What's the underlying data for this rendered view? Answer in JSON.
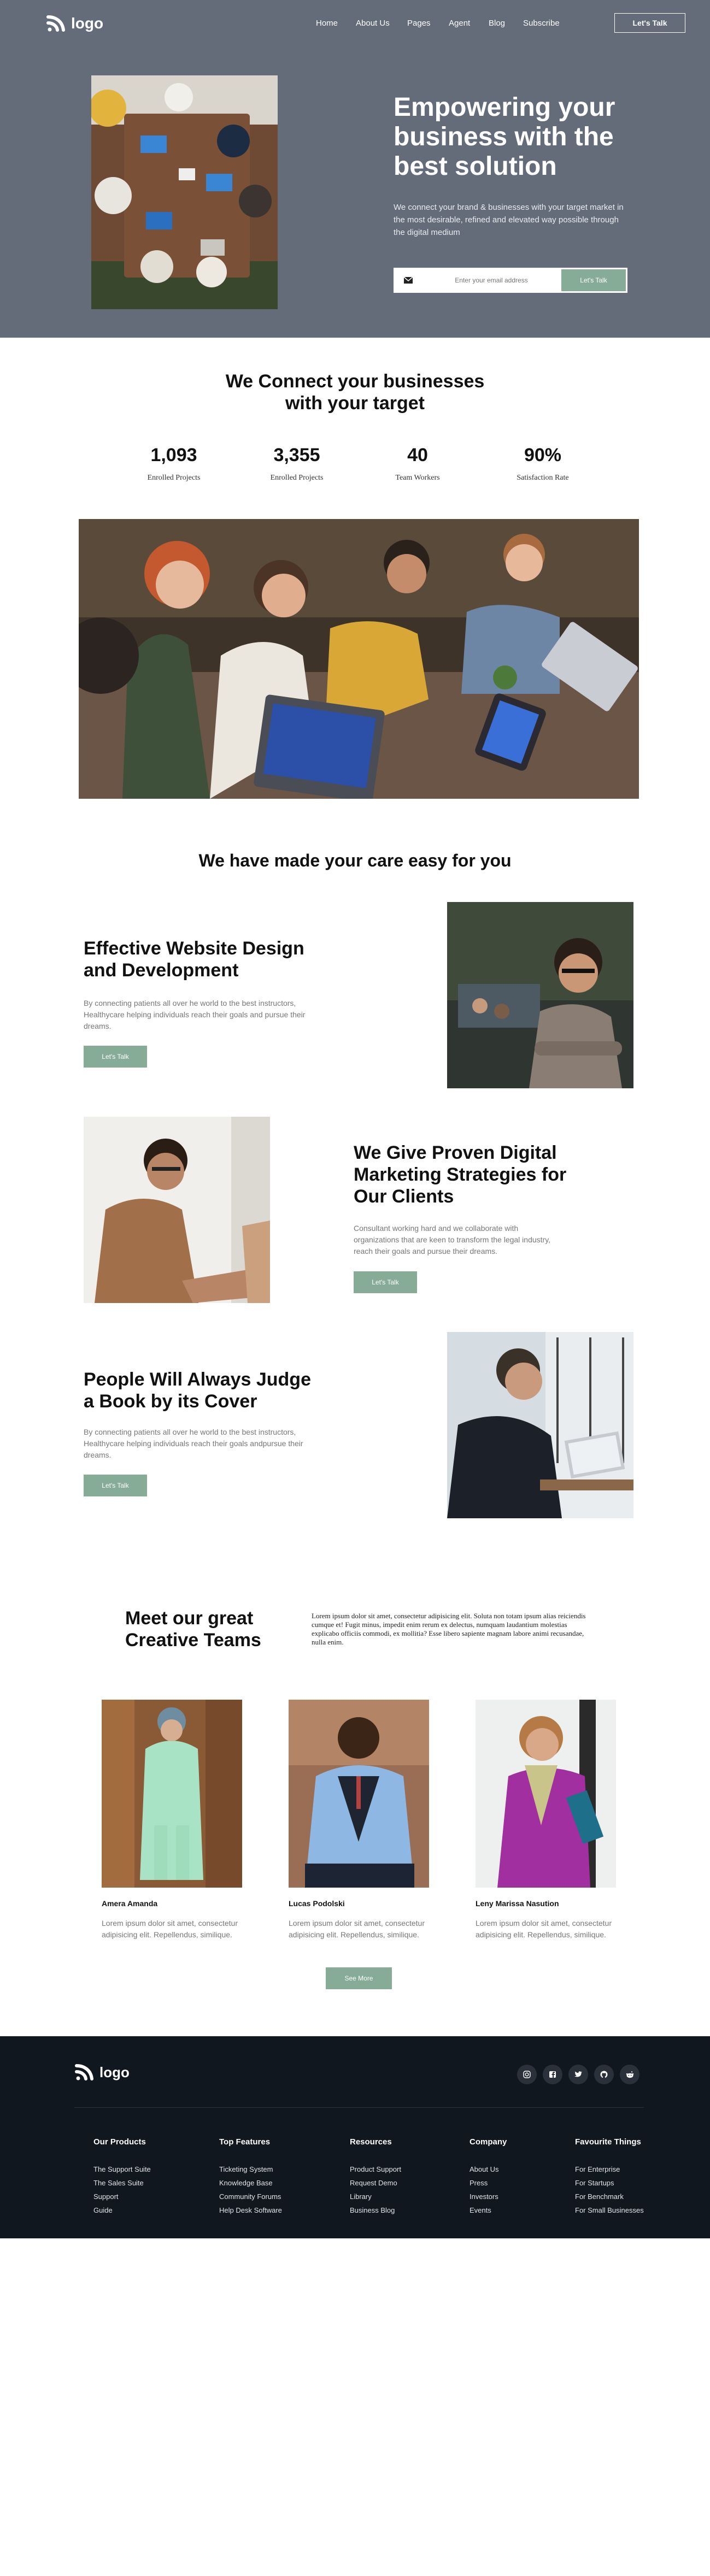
{
  "brand": {
    "logo_text": "logo"
  },
  "nav": {
    "items": [
      "Home",
      "About Us",
      "Pages",
      "Agent",
      "Blog",
      "Subscribe"
    ],
    "cta_label": "Let's Talk"
  },
  "hero": {
    "title": "Empowering your business with the best solution",
    "description": "We connect your brand & businesses with your target market in the most desirable, refined and elevated way possible through the digital medium",
    "email_placeholder": "Enter your email address",
    "email_button": "Let's Talk"
  },
  "connect": {
    "title": "We Connect your businesses with your target",
    "stats": [
      {
        "value": "1,093",
        "label": "Enrolled Projects"
      },
      {
        "value": "3,355",
        "label": "Enrolled Projects"
      },
      {
        "value": "40",
        "label": "Team Workers"
      },
      {
        "value": "90%",
        "label": "Satisfaction Rate"
      }
    ]
  },
  "care": {
    "title": "We have made your care easy for you"
  },
  "features": [
    {
      "title": "Effective Website Design and Development",
      "description": "By connecting patients all over he world to the best instructors, Healthycare helping individuals reach their goals and pursue their dreams.",
      "button": "Let's Talk"
    },
    {
      "title": "We Give Proven Digital Marketing Strategies for Our Clients",
      "description": "Consultant working hard and we collaborate with organizations that are keen to transform the legal industry, reach their goals and pursue their dreams.",
      "button": "Let's Talk"
    },
    {
      "title": "People Will Always Judge a Book by its Cover",
      "description": "By connecting patients all over he world to the best instructors, Healthycare helping individuals reach their goals andpursue their dreams.",
      "button": "Let's Talk"
    }
  ],
  "team": {
    "title": "Meet our great Creative Teams",
    "description": "Lorem ipsum dolor sit amet, consectetur adipisicing elit. Soluta non totam ipsum alias reiciendis cumque et! Fugit minus, impedit enim rerum ex delectus, numquam laudantium molestias explicabo officiis commodi, ex mollitia? Esse libero sapiente magnam labore animi recusandae, nulla enim.",
    "members": [
      {
        "name": "Amera Amanda",
        "description": "Lorem ipsum dolor sit amet, consectetur adipisicing elit. Repellendus, similique."
      },
      {
        "name": "Lucas Podolski",
        "description": "Lorem ipsum dolor sit amet, consectetur adipisicing elit. Repellendus, similique."
      },
      {
        "name": "Leny Marissa Nasution",
        "description": "Lorem ipsum dolor sit amet, consectetur adipisicing elit. Repellendus, similique."
      }
    ],
    "see_more": "See More"
  },
  "footer": {
    "logo_text": "logo",
    "socials": [
      "instagram-icon",
      "facebook-icon",
      "twitter-icon",
      "github-icon",
      "reddit-icon"
    ],
    "columns": [
      {
        "title": "Our Products",
        "links": [
          "The Support Suite",
          "The Sales Suite",
          "Support",
          "Guide"
        ]
      },
      {
        "title": "Top Features",
        "links": [
          "Ticketing System",
          "Knowledge Base",
          "Community Forums",
          "Help Desk Software"
        ]
      },
      {
        "title": "Resources",
        "links": [
          "Product Support",
          "Request Demo",
          "Library",
          "Business Blog"
        ]
      },
      {
        "title": "Company",
        "links": [
          "About Us",
          "Press",
          "Investors",
          "Events"
        ]
      },
      {
        "title": "Favourite Things",
        "links": [
          "For Enterprise",
          "For Startups",
          "For Benchmark",
          "For Small Businesses"
        ]
      }
    ]
  },
  "colors": {
    "hero_bg": "#646b79",
    "accent_green": "#86ac97",
    "footer_bg": "#11171f"
  }
}
